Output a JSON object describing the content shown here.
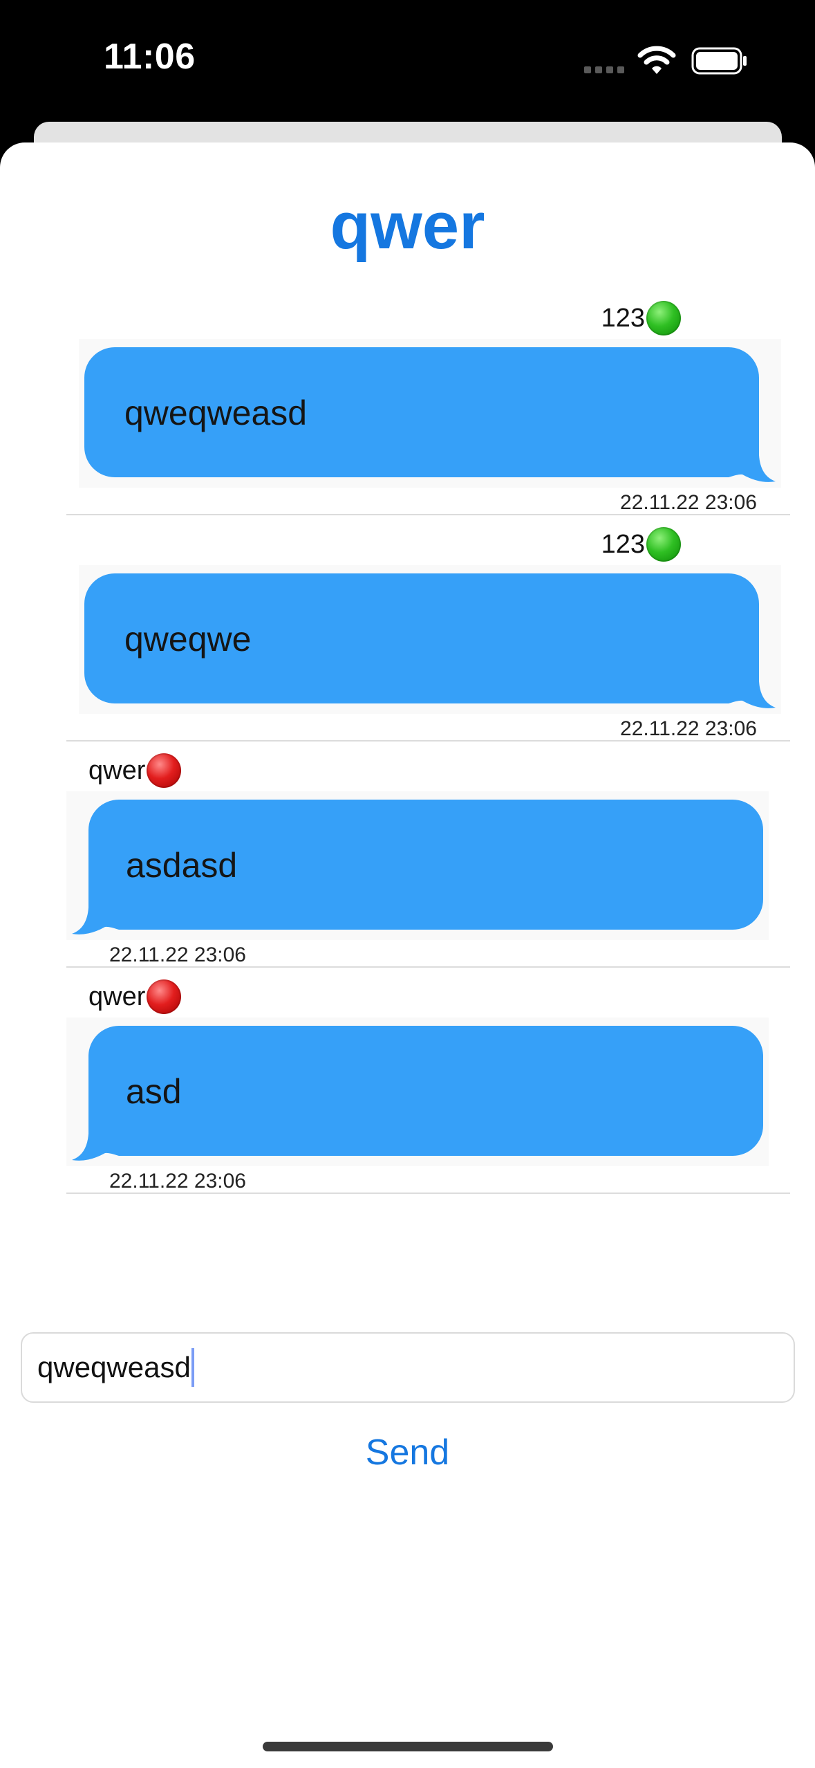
{
  "status_bar": {
    "time": "11:06",
    "icons": [
      "signal-icon",
      "wifi-icon",
      "battery-icon"
    ]
  },
  "chat": {
    "title": "qwer"
  },
  "messages": [
    {
      "sender": "123",
      "status": "online",
      "text": "qweqweasd",
      "timestamp": "22.11.22 23:06",
      "align": "right"
    },
    {
      "sender": "123",
      "status": "online",
      "text": "qweqwe",
      "timestamp": "22.11.22 23:06",
      "align": "right"
    },
    {
      "sender": "qwer",
      "status": "offline",
      "text": "asdasd",
      "timestamp": "22.11.22 23:06",
      "align": "left"
    },
    {
      "sender": "qwer",
      "status": "offline",
      "text": "asd",
      "timestamp": "22.11.22 23:06",
      "align": "left"
    }
  ],
  "composer": {
    "value": "qweqweasd",
    "send_label": "Send"
  },
  "colors": {
    "accent": "#1577e0",
    "bubble": "#36a0f8",
    "online": "#2fbf23",
    "offline": "#e21e1e"
  }
}
